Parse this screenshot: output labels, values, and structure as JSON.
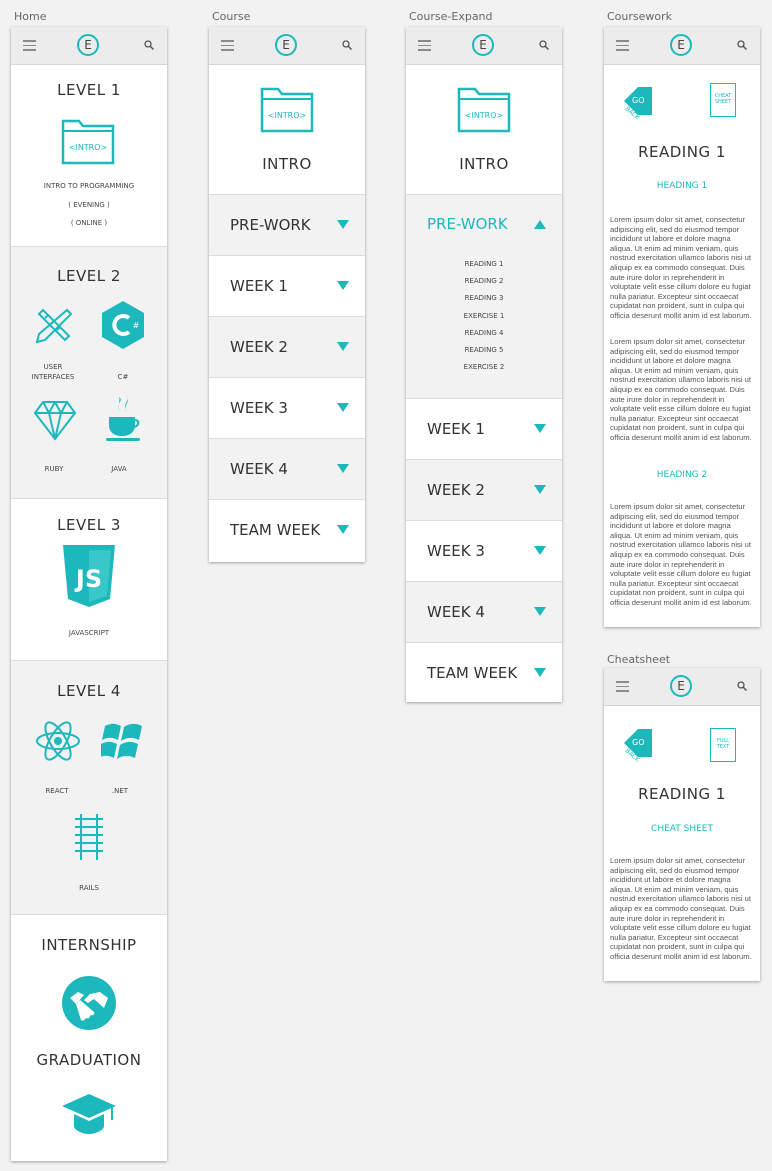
{
  "labels": {
    "home": "Home",
    "course": "Course",
    "course_expand": "Course-Expand",
    "coursework": "Coursework",
    "cheatsheet": "Cheatsheet"
  },
  "nav": {
    "logo": "E"
  },
  "home": {
    "level1": {
      "title": "LEVEL 1",
      "folder": "<INTRO>",
      "line1": "INTRO TO PROGRAMMING",
      "line2": "( EVENING )",
      "line3": "( ONLINE )"
    },
    "level2": {
      "title": "LEVEL 2",
      "items": [
        "USER INTERFACES",
        "C#",
        "RUBY",
        "JAVA"
      ]
    },
    "level3": {
      "title": "LEVEL 3",
      "items": [
        "JAVASCRIPT"
      ]
    },
    "level4": {
      "title": "LEVEL 4",
      "items": [
        "REACT",
        ".NET",
        "RAILS"
      ]
    },
    "internship": "INTERNSHIP",
    "graduation": "GRADUATION"
  },
  "course": {
    "folder": "<INTRO>",
    "title": "INTRO",
    "rows": [
      "PRE-WORK",
      "WEEK 1",
      "WEEK 2",
      "WEEK 3",
      "WEEK 4",
      "TEAM WEEK"
    ]
  },
  "expand": {
    "folder": "<INTRO>",
    "title": "INTRO",
    "open": "PRE-WORK",
    "subitems": [
      "READING 1",
      "READING 2",
      "READING 3",
      "EXERCISE 1",
      "READING 4",
      "READING 5",
      "EXERCISE 2"
    ],
    "rows": [
      "WEEK 1",
      "WEEK 2",
      "WEEK 3",
      "WEEK 4",
      "TEAM WEEK"
    ]
  },
  "coursework": {
    "go": "GO",
    "back": "BACK",
    "doc": "CHEAT SHEET",
    "title": "READING 1",
    "heading1": "HEADING 1",
    "heading2": "HEADING 2",
    "p1": "Lorem ipsum dolor sit amet, consectetur adipiscing elit, sed do eiusmod tempor incididunt ut labore et dolore magna aliqua. Ut enim ad minim veniam, quis nostrud exercitation ullamco laboris nisi ut aliquip ex ea commodo consequat. Duis aute irure dolor in reprehenderit in voluptate velit esse cillum dolore eu fugiat nulla pariatur. Excepteur sint occaecat cupidatat non proident, sunt in culpa qui officia deserunt mollit anim id est laborum.",
    "p2": "Lorem ipsum dolor sit amet, consectetur adipiscing elit, sed do eiusmod tempor incididunt ut labore et dolore magna aliqua. Ut enim ad minim veniam, quis nostrud exercitation ullamco laboris nisi ut aliquip ex ea commodo consequat. Duis aute irure dolor in reprehenderit in voluptate velit esse cillum dolore eu fugiat nulla pariatur. Excepteur sint occaecat cupidatat non proident, sunt in culpa qui officia deserunt mollit anim id est laborum.",
    "p3": "Lorem ipsum dolor sit amet, consectetur adipiscing elit, sed do eiusmod tempor incididunt ut labore et dolore magna aliqua. Ut enim ad minim veniam, quis nostrud exercitation ullamco laboris nisi ut aliquip ex ea commodo consequat. Duis aute irure dolor in reprehenderit in voluptate velit esse cillum dolore eu fugiat nulla pariatur. Excepteur sint occaecat cupidatat non proident, sunt in culpa qui officia deserunt mollit anim id est laborum."
  },
  "cheatsheet": {
    "go": "GO",
    "back": "BACK",
    "doc": "FULL TEXT",
    "title": "READING 1",
    "heading": "CHEAT SHEET",
    "p1": "Lorem ipsum dolor sit amet, consectetur adipiscing elit, sed do eiusmod tempor incididunt ut labore et dolore magna aliqua. Ut enim ad minim veniam, quis nostrud exercitation ullamco laboris nisi ut aliquip ex ea commodo consequat. Duis aute irure dolor in reprehenderit in voluptate velit esse cillum dolore eu fugiat nulla pariatur. Excepteur sint occaecat cupidatat non proident, sunt in culpa qui officia deserunt mollit anim id est laborum."
  },
  "colors": {
    "accent": "#1cb8bc",
    "background": "#f2f2f2"
  }
}
